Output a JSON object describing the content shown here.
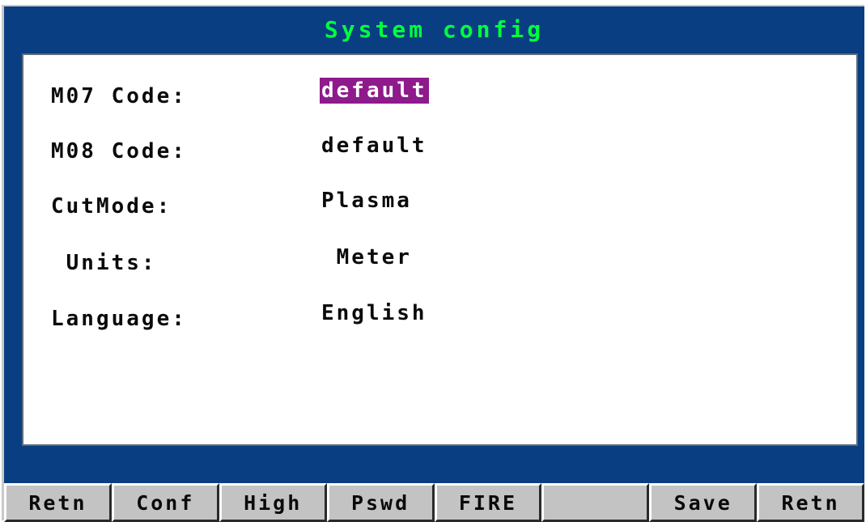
{
  "window": {
    "title": "System config"
  },
  "settings": [
    {
      "label": "M07 Code:",
      "value": "default",
      "selected": true
    },
    {
      "label": "M08 Code:",
      "value": "default",
      "selected": false
    },
    {
      "label": "CutMode:",
      "value": "Plasma",
      "selected": false
    },
    {
      "label": " Units:",
      "value": " Meter",
      "selected": false
    },
    {
      "label": "Language:",
      "value": "English",
      "selected": false
    }
  ],
  "softkeys": [
    {
      "label": "Retn"
    },
    {
      "label": "Conf"
    },
    {
      "label": "High"
    },
    {
      "label": "Pswd"
    },
    {
      "label": "FIRE"
    },
    {
      "label": ""
    },
    {
      "label": "Save"
    },
    {
      "label": "Retn"
    }
  ],
  "colors": {
    "frame": "#0a3e82",
    "title_text": "#00ff40",
    "panel": "#ffffff",
    "selection": "#8e1a8c",
    "softkey_face": "#c3c3c3"
  }
}
